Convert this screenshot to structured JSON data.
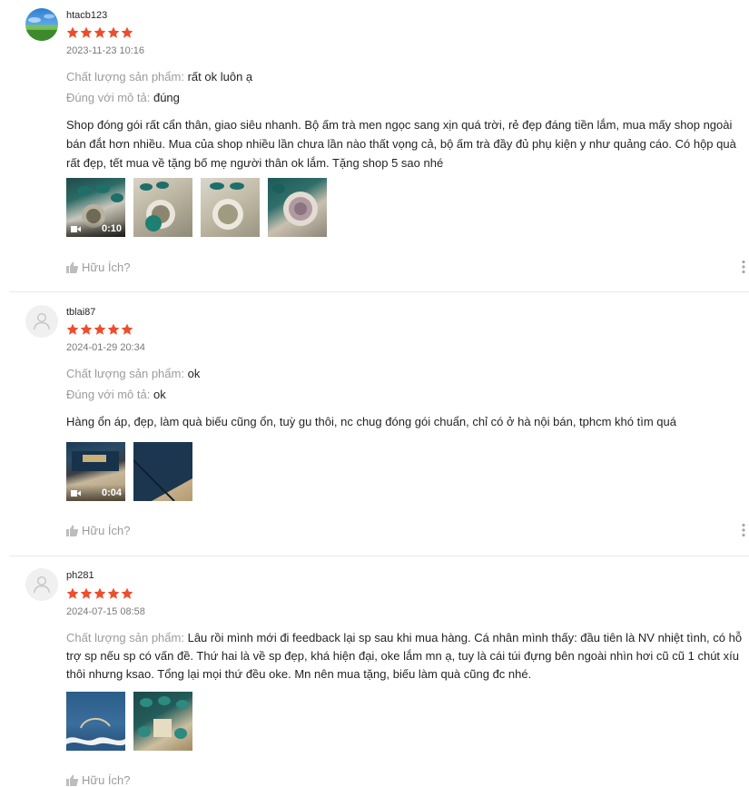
{
  "labels": {
    "quality": "Chất lượng sản phẩm:",
    "description": "Đúng với mô tả:",
    "helpful": "Hữu Ích?"
  },
  "colors": {
    "star": "#ee4d2d",
    "accent": "#ee4d2d"
  },
  "icons": [
    "star-icon",
    "play-video-icon",
    "thumbs-up-icon",
    "more-vertical-icon",
    "default-avatar-icon"
  ],
  "reviews": [
    {
      "username": "htacb123",
      "rating": 5,
      "datetime": "2023-11-23 10:16",
      "quality": "rất ok luôn ạ",
      "description": "đúng",
      "comment": "Shop đóng gói rất cẩn thân, giao siêu nhanh. Bộ ấm trà men ngọc sang xịn quá trời, rẻ đẹp đáng tiền lắm, mua mấy shop ngoài bán đắt hơn nhiều. Mua của shop nhiều lần chưa lần nào thất vọng cả, bộ ấm trà đầy đủ phụ kiện y như quảng cáo. Có hộp quà rất đẹp, tết mua về tặng bố mẹ người thân ok lắm. Tặng shop 5 sao nhé",
      "media": [
        {
          "type": "video",
          "duration": "0:10"
        },
        {
          "type": "image"
        },
        {
          "type": "image"
        },
        {
          "type": "image"
        }
      ]
    },
    {
      "username": "tblai87",
      "rating": 5,
      "datetime": "2024-01-29 20:34",
      "quality": "ok",
      "description": "ok",
      "comment": "Hàng ổn áp, đẹp, làm quà biếu cũng ổn, tuỳ gu thôi, nc chug đóng gói chuẩn, chỉ có ở hà nội bán, tphcm khó tìm quá",
      "media": [
        {
          "type": "video",
          "duration": "0:04"
        },
        {
          "type": "image"
        }
      ]
    },
    {
      "username": "ph281",
      "rating": 5,
      "datetime": "2024-07-15 08:58",
      "quality": "Lâu rồi mình mới đi feedback lại sp sau khi mua hàng. Cá nhân mình thấy: đầu tiên là  NV nhiệt tình, có hỗ trợ sp nếu sp có vấn đề. Thứ hai là về sp đẹp, khá hiện đại, oke lắm mn ạ, tuy là cái túi đựng bên ngoài nhìn hơi cũ cũ 1 chút xíu thôi nhưng ksao. Tổng lại mọi thứ đều oke. Mn nên mua tặng, biếu làm quà cũng đc nhé.",
      "media": [
        {
          "type": "image"
        },
        {
          "type": "image"
        }
      ]
    }
  ]
}
